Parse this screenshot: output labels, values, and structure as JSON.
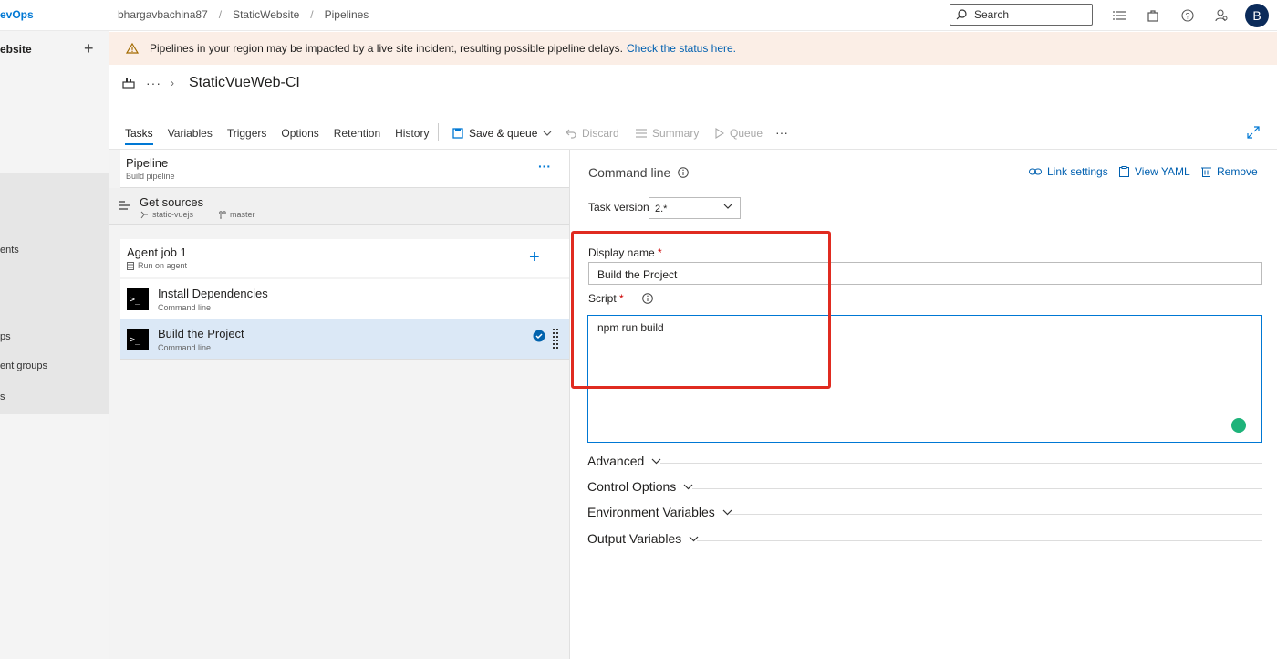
{
  "header": {
    "brand": "evOps",
    "breadcrumbs": [
      "bhargavbachina87",
      "StaticWebsite",
      "Pipelines"
    ],
    "breadcrumb_sep": "/",
    "search_placeholder": "Search",
    "avatar_initial": "B"
  },
  "sidebar": {
    "project": "ebsite",
    "items": [
      {
        "label": "ents"
      },
      {
        "label": "ps"
      },
      {
        "label": "ent groups"
      },
      {
        "label": "s"
      }
    ]
  },
  "banner": {
    "text": "Pipelines in your region may be impacted by a live site incident, resulting possible pipeline delays.",
    "link": "Check the status here."
  },
  "page": {
    "more": "···",
    "title": "StaticVueWeb-CI"
  },
  "tabs": [
    "Tasks",
    "Variables",
    "Triggers",
    "Options",
    "Retention",
    "History"
  ],
  "toolbar": {
    "save": "Save & queue",
    "discard": "Discard",
    "summary": "Summary",
    "queue": "Queue",
    "more": "···"
  },
  "pipeline": {
    "title": "Pipeline",
    "subtitle": "Build pipeline",
    "more": "···",
    "get_sources": {
      "title": "Get sources",
      "repo": "static-vuejs",
      "branch": "master"
    },
    "agent_job": {
      "title": "Agent job 1",
      "subtitle": "Run on agent",
      "add": "+"
    },
    "tasks": [
      {
        "title": "Install Dependencies",
        "subtitle": "Command line",
        "icon": ">_"
      },
      {
        "title": "Build the Project",
        "subtitle": "Command line",
        "icon": ">_"
      }
    ]
  },
  "detail": {
    "title": "Command line",
    "link_settings": "Link settings",
    "view_yaml": "View YAML",
    "remove": "Remove",
    "task_version_label": "Task version",
    "task_version": "2.*",
    "display_name_label": "Display name",
    "display_name": "Build the Project",
    "script_label": "Script",
    "required": "*",
    "script": "npm run build",
    "sections": [
      "Advanced",
      "Control Options",
      "Environment Variables",
      "Output Variables"
    ]
  }
}
